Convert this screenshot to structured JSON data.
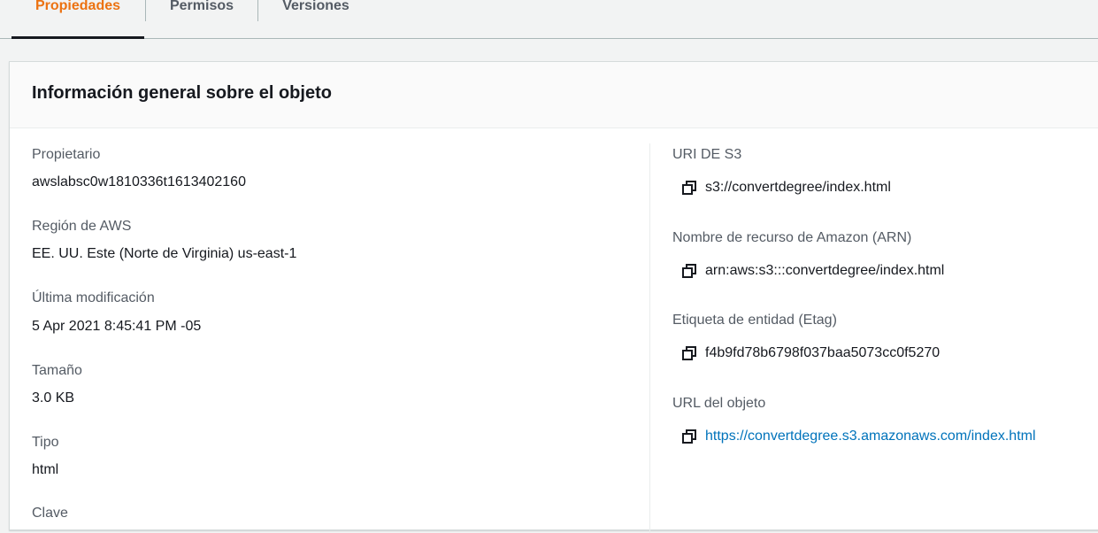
{
  "tabs": [
    {
      "label": "Propiedades",
      "active": true
    },
    {
      "label": "Permisos",
      "active": false
    },
    {
      "label": "Versiones",
      "active": false
    }
  ],
  "panel": {
    "title": "Información general sobre el objeto"
  },
  "left_fields": {
    "owner": {
      "label": "Propietario",
      "value": "awslabsc0w1810336t1613402160"
    },
    "region": {
      "label": "Región de AWS",
      "value": "EE. UU. Este (Norte de Virginia) us-east-1"
    },
    "last_modified": {
      "label": "Última modificación",
      "value": "5 Apr 2021 8:45:41 PM -05"
    },
    "size": {
      "label": "Tamaño",
      "value": "3.0 KB"
    },
    "type": {
      "label": "Tipo",
      "value": "html"
    },
    "key": {
      "label": "Clave"
    }
  },
  "right_fields": {
    "s3_uri": {
      "label": "URI DE S3",
      "value": "s3://convertdegree/index.html"
    },
    "arn": {
      "label": "Nombre de recurso de Amazon (ARN)",
      "value": "arn:aws:s3:::convertdegree/index.html"
    },
    "etag": {
      "label": "Etiqueta de entidad (Etag)",
      "value": "f4b9fd78b6798f037baa5073cc0f5270"
    },
    "object_url": {
      "label": "URL del objeto",
      "value": "https://convertdegree.s3.amazonaws.com/index.html"
    }
  },
  "colors": {
    "accent": "#ec7211",
    "link": "#0073bb",
    "text": "#16191f",
    "label": "#545b64"
  },
  "icons": {
    "copy": "copy-icon"
  }
}
